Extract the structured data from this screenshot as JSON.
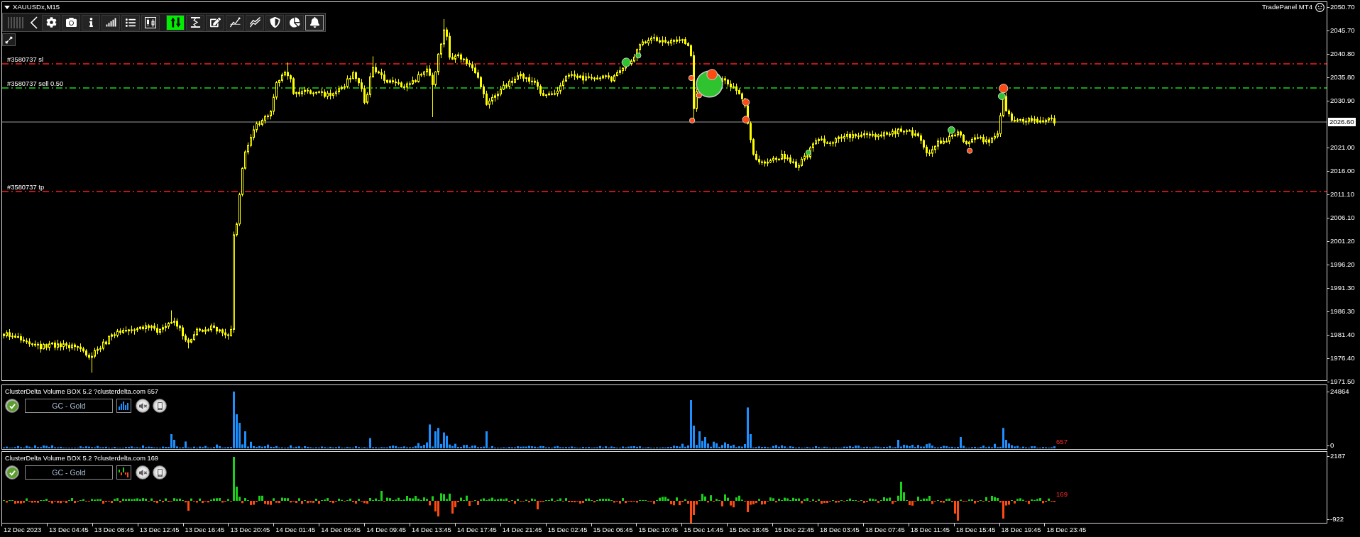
{
  "chart_window": {
    "title": "XAUUSDx,M15",
    "panel_label": "TradePanel MT4"
  },
  "toolbar": {
    "buttons": [
      {
        "selected": false,
        "highlighted": false
      },
      {
        "selected": false,
        "highlighted": false
      },
      {
        "selected": false,
        "highlighted": false
      },
      {
        "selected": false,
        "highlighted": false
      },
      {
        "selected": false,
        "highlighted": false
      },
      {
        "selected": false,
        "highlighted": false
      },
      {
        "selected": true,
        "highlighted": false
      },
      {
        "selected": false,
        "highlighted": false
      },
      {
        "selected": false,
        "highlighted": false
      },
      {
        "selected": false,
        "highlighted": false
      },
      {
        "selected": false,
        "highlighted": false
      },
      {
        "selected": false,
        "highlighted": false
      },
      {
        "selected": false,
        "highlighted": false
      },
      {
        "selected": false,
        "highlighted": true
      }
    ]
  },
  "order_lines": [
    {
      "label": "#3580737 sl",
      "kind": "stop_loss"
    },
    {
      "label": "#3580737 sell 0.50",
      "kind": "entry"
    },
    {
      "label": "#3580737 tp",
      "kind": "take_profit"
    }
  ],
  "price_axis": {
    "labels": [
      {
        "text": "2050.70",
        "kind": "tick"
      },
      {
        "text": "2045.70",
        "kind": "tick"
      },
      {
        "text": "2040.80",
        "kind": "tick"
      },
      {
        "text": "2035.80",
        "kind": "tick"
      },
      {
        "text": "2030.90",
        "kind": "tick"
      },
      {
        "text": "2026.60",
        "kind": "current"
      },
      {
        "text": "2021.00",
        "kind": "tick"
      },
      {
        "text": "2016.00",
        "kind": "tick"
      },
      {
        "text": "2011.10",
        "kind": "tick"
      },
      {
        "text": "2006.10",
        "kind": "tick"
      },
      {
        "text": "2001.20",
        "kind": "tick"
      },
      {
        "text": "1996.20",
        "kind": "tick"
      },
      {
        "text": "1991.30",
        "kind": "tick"
      },
      {
        "text": "1986.30",
        "kind": "tick"
      },
      {
        "text": "1981.40",
        "kind": "tick"
      },
      {
        "text": "1976.40",
        "kind": "tick"
      },
      {
        "text": "1971.50",
        "kind": "tick"
      }
    ]
  },
  "indicators": [
    {
      "title": "ClusterDelta Volume BOX 5.2 ?clusterdelta.com 657",
      "enabled": true,
      "symbol": "GC - Gold",
      "kind": "volume",
      "value": "657",
      "axis_labels": [
        "24864",
        "0"
      ]
    },
    {
      "title": "ClusterDelta Volume BOX 5.2 ?clusterdelta.com 169",
      "enabled": true,
      "symbol": "GC - Gold",
      "kind": "delta",
      "value": "169",
      "axis_labels": [
        "2187",
        "-922"
      ]
    }
  ],
  "time_axis": {
    "labels": [
      "12 Dec 2023",
      "13 Dec 04:45",
      "13 Dec 08:45",
      "13 Dec 12:45",
      "13 Dec 16:45",
      "13 Dec 20:45",
      "14 Dec 01:45",
      "14 Dec 05:45",
      "14 Dec 09:45",
      "14 Dec 13:45",
      "14 Dec 17:45",
      "14 Dec 21:45",
      "15 Dec 02:45",
      "15 Dec 06:45",
      "15 Dec 10:45",
      "15 Dec 14:45",
      "15 Dec 18:45",
      "15 Dec 22:45",
      "18 Dec 03:45",
      "18 Dec 07:45",
      "18 Dec 11:45",
      "18 Dec 15:45",
      "18 Dec 19:45",
      "18 Dec 23:45"
    ]
  }
}
